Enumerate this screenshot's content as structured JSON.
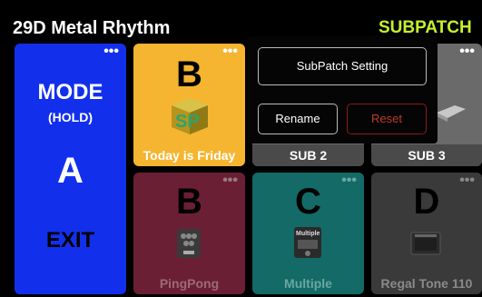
{
  "header": {
    "title": "29D Metal Rhythm",
    "subpatch": "SUBPATCH"
  },
  "mode_card": {
    "line1": "MODE",
    "line2": "(HOLD)",
    "letter": "A",
    "exit": "EXIT",
    "menu": "•••"
  },
  "cards": [
    {
      "letter": "B",
      "label": "Today is Friday",
      "menu": "•••"
    },
    {
      "letter": "",
      "label": "SUB 2",
      "menu": ""
    },
    {
      "letter": "",
      "label": "SUB 3",
      "menu": "•••"
    },
    {
      "letter": "B",
      "label": "PingPong",
      "menu": "•••"
    },
    {
      "letter": "C",
      "label": "Multiple",
      "menu": "•••"
    },
    {
      "letter": "D",
      "label": "Regal Tone 110",
      "menu": "•••"
    }
  ],
  "pedal_text": {
    "multiple": "Multiple"
  },
  "popup": {
    "setting": "SubPatch Setting",
    "rename": "Rename",
    "reset": "Reset"
  },
  "colors": {
    "accent": "#c5f02d",
    "mode": "#1230ec",
    "card1": "#f5b530",
    "reset": "#c0392b"
  }
}
